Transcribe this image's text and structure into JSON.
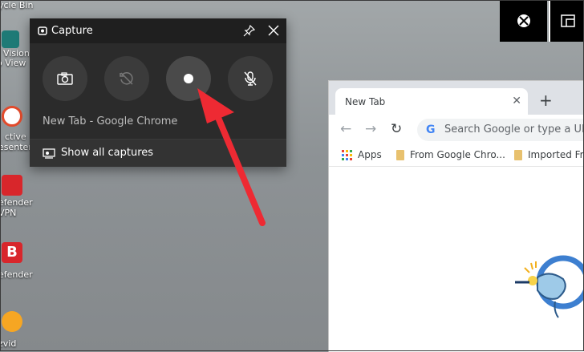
{
  "desktop": {
    "icons": [
      {
        "label": "ycle Bin"
      },
      {
        "label": "Vision"
      },
      {
        "label": "o View"
      },
      {
        "label": "ctive"
      },
      {
        "label": "esenter"
      },
      {
        "label": "efender"
      },
      {
        "label": "VPN"
      },
      {
        "label": "efender"
      },
      {
        "label": "zvid"
      }
    ]
  },
  "gamebar": {
    "capture": {
      "title": "Capture",
      "source": "New Tab - Google Chrome",
      "show_all": "Show all captures",
      "buttons": [
        "screenshot-icon",
        "record-last-icon",
        "record-icon",
        "mic-off-icon"
      ]
    },
    "xbox_icon": "xbox-icon",
    "widget_icon": "widget-menu-icon"
  },
  "chrome": {
    "tab_title": "New Tab",
    "omnibox_placeholder": "Search Google or type a URL",
    "bookmarks": [
      "Apps",
      "From Google Chro...",
      "Imported Fro"
    ]
  },
  "colors": {
    "annotation_arrow": "#ee2a33",
    "capture_bg": "#2b2b2b"
  }
}
